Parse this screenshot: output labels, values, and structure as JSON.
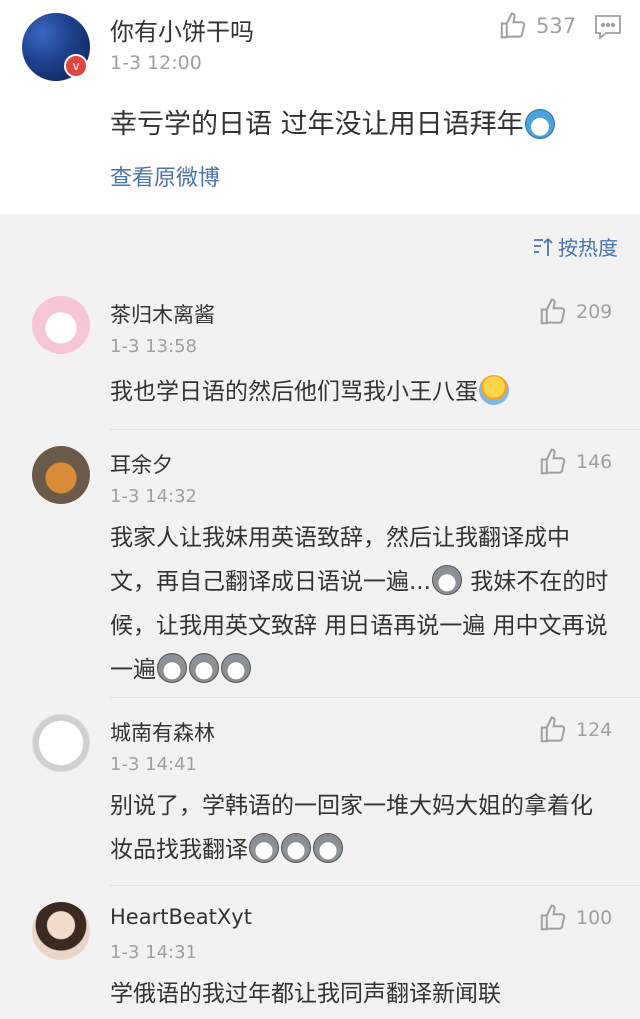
{
  "post": {
    "author": "你有小饼干吗",
    "time": "1-3 12:00",
    "likes": "537",
    "text": "幸亏学的日语 过年没让用日语拜年",
    "emoji": "doraemon-emoji",
    "view_original": "查看原微博",
    "badge": "v"
  },
  "sort": {
    "label": "按热度"
  },
  "comments": [
    {
      "author": "茶归木离酱",
      "time": "1-3 13:58",
      "likes": "209",
      "text": "我也学日语的然后他们骂我小王八蛋",
      "avatar_color": "#f7c6d6"
    },
    {
      "author": "耳余夕",
      "time": "1-3 14:32",
      "likes": "146",
      "text": "我家人让我妹用英语致辞，然后让我翻译成中文，再自己翻译成日语说一遍...",
      "text2": "我妹不在的时候，让我用英文致辞 用日语再说一遍 用中文再说一遍",
      "avatar_color": "#6b5a4a"
    },
    {
      "author": "城南有森林",
      "time": "1-3 14:41",
      "likes": "124",
      "text": "别说了，学韩语的一回家一堆大妈大姐的拿着化妆品找我翻译",
      "avatar_color": "#f5f5f5"
    },
    {
      "author": "HeartBeatXyt",
      "time": "1-3 14:31",
      "likes": "100",
      "text": "学俄语的我过年都让我同声翻译新闻联",
      "avatar_color": "#e8d7c8"
    }
  ],
  "colors": {
    "link": "#4a73b0",
    "meta": "#a0a0a0",
    "text": "#333333",
    "background": "#f2f2f2"
  }
}
